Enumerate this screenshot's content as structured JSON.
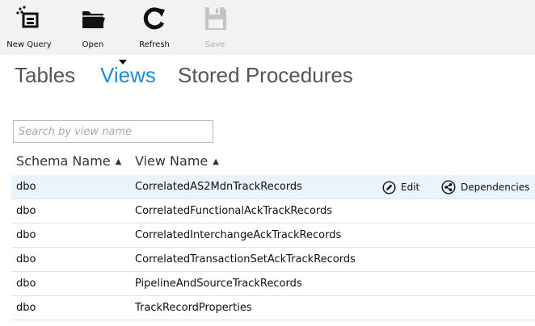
{
  "toolbar": {
    "new_query": "New Query",
    "open": "Open",
    "refresh": "Refresh",
    "save": "Save"
  },
  "tabs": {
    "tables": "Tables",
    "views": "Views",
    "stored_procedures": "Stored Procedures",
    "active": "Views"
  },
  "search": {
    "placeholder": "Search by view name",
    "value": ""
  },
  "columns": {
    "schema": "Schema Name",
    "view": "View Name",
    "sort_arrow": "▲"
  },
  "actions": {
    "edit": "Edit",
    "dependencies": "Dependencies"
  },
  "rows": [
    {
      "schema": "dbo",
      "view": "CorrelatedAS2MdnTrackRecords"
    },
    {
      "schema": "dbo",
      "view": "CorrelatedFunctionalAckTrackRecords"
    },
    {
      "schema": "dbo",
      "view": "CorrelatedInterchangeAckTrackRecords"
    },
    {
      "schema": "dbo",
      "view": "CorrelatedTransactionSetAckTrackRecords"
    },
    {
      "schema": "dbo",
      "view": "PipelineAndSourceTrackRecords"
    },
    {
      "schema": "dbo",
      "view": "TrackRecordProperties"
    }
  ],
  "icons": {
    "new_query": "new-query-icon",
    "open": "folder-icon",
    "refresh": "refresh-icon",
    "save": "floppy-disk-icon",
    "edit": "pencil-circle-icon",
    "dependencies": "dependencies-icon"
  },
  "colors": {
    "accent": "#1c8ad6",
    "toolbar_bg": "#f2f2f2",
    "selected_row": "#eaf4fb"
  }
}
